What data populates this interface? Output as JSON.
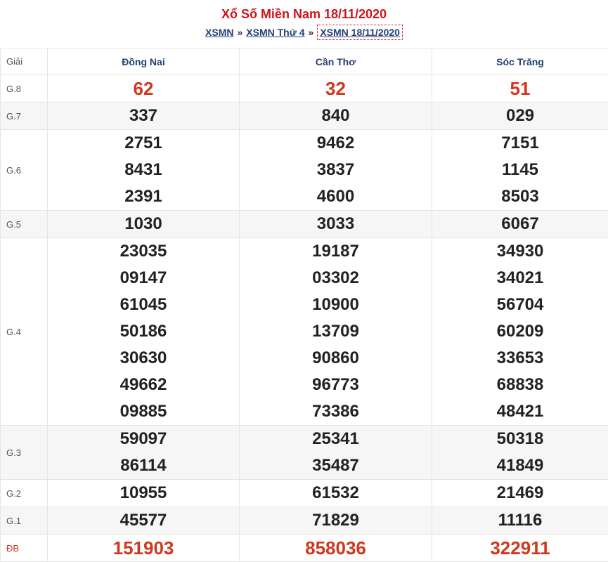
{
  "header": {
    "title": "Xổ Số Miền Nam 18/11/2020",
    "breadcrumbs": [
      "XSMN",
      "XSMN Thứ 4",
      "XSMN 18/11/2020"
    ],
    "separator": "»"
  },
  "table": {
    "label_header": "Giải",
    "provinces": [
      "Đồng Nai",
      "Cần Thơ",
      "Sóc Trăng"
    ],
    "rows": [
      {
        "label": "G.8",
        "values": [
          [
            "62"
          ],
          [
            "32"
          ],
          [
            "51"
          ]
        ]
      },
      {
        "label": "G.7",
        "values": [
          [
            "337"
          ],
          [
            "840"
          ],
          [
            "029"
          ]
        ]
      },
      {
        "label": "G.6",
        "values": [
          [
            "2751",
            "8431",
            "2391"
          ],
          [
            "9462",
            "3837",
            "4600"
          ],
          [
            "7151",
            "1145",
            "8503"
          ]
        ]
      },
      {
        "label": "G.5",
        "values": [
          [
            "1030"
          ],
          [
            "3033"
          ],
          [
            "6067"
          ]
        ]
      },
      {
        "label": "G.4",
        "values": [
          [
            "23035",
            "09147",
            "61045",
            "50186",
            "30630",
            "49662",
            "09885"
          ],
          [
            "19187",
            "03302",
            "10900",
            "13709",
            "90860",
            "96773",
            "73386"
          ],
          [
            "34930",
            "34021",
            "56704",
            "60209",
            "33653",
            "68838",
            "48421"
          ]
        ]
      },
      {
        "label": "G.3",
        "values": [
          [
            "59097",
            "86114"
          ],
          [
            "25341",
            "35487"
          ],
          [
            "50318",
            "41849"
          ]
        ]
      },
      {
        "label": "G.2",
        "values": [
          [
            "10955"
          ],
          [
            "61532"
          ],
          [
            "21469"
          ]
        ]
      },
      {
        "label": "G.1",
        "values": [
          [
            "45577"
          ],
          [
            "71829"
          ],
          [
            "11116"
          ]
        ]
      },
      {
        "label": "ĐB",
        "values": [
          [
            "151903"
          ],
          [
            "858036"
          ],
          [
            "322911"
          ]
        ]
      }
    ]
  },
  "colors": {
    "title": "#d0131d",
    "link": "#213f74",
    "special": "#d0381d"
  }
}
